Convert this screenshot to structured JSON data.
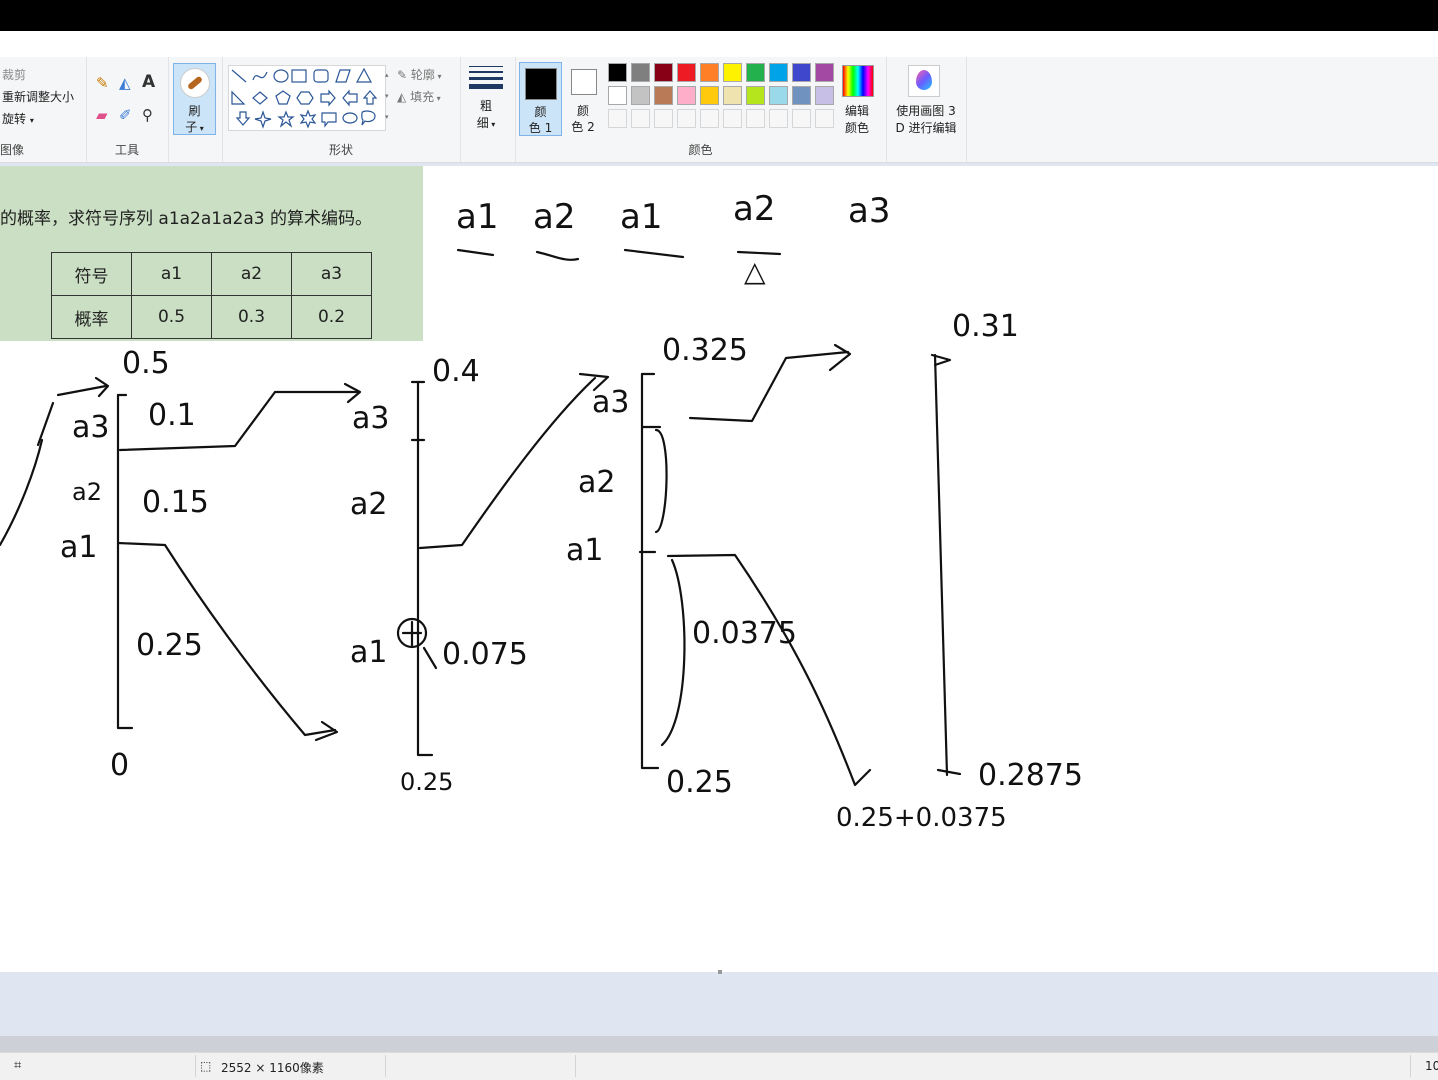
{
  "ribbon": {
    "image_group": {
      "crop": "裁剪",
      "resize": "重新调整大小",
      "rotate": "旋转",
      "label": "图像"
    },
    "tools_group": {
      "label": "工具"
    },
    "brush": {
      "line1": "刷",
      "line2": "子"
    },
    "shapes_group": {
      "outline": "轮廓",
      "fill": "填充",
      "label": "形状"
    },
    "size": {
      "line1": "粗",
      "line2": "细"
    },
    "color1": {
      "line1": "颜",
      "line2": "色 1"
    },
    "color2": {
      "line1": "颜",
      "line2": "色 2"
    },
    "edit_colors": {
      "line1": "编辑",
      "line2": "颜色"
    },
    "paint3d": {
      "line1": "使用画图 3",
      "line2": "D 进行编辑"
    },
    "colors_label": "颜色",
    "palette_row1": [
      "#000000",
      "#7f7f7f",
      "#880015",
      "#ed1c24",
      "#ff7f27",
      "#fff200",
      "#22b14c",
      "#00a2e8",
      "#3f48cc",
      "#a349a4"
    ],
    "palette_row2": [
      "#ffffff",
      "#c3c3c3",
      "#b97a57",
      "#ffaec9",
      "#ffc90e",
      "#efe4b0",
      "#b5e61d",
      "#99d9ea",
      "#7092be",
      "#c8bfe7"
    ],
    "color1_value": "#000000",
    "color2_value": "#ffffff"
  },
  "pasted_image": {
    "question": "的概率，求符号序列 a1a2a1a2a3 的算术编码。",
    "table": [
      [
        "符号",
        "a1",
        "a2",
        "a3"
      ],
      [
        "概率",
        "0.5",
        "0.3",
        "0.2"
      ]
    ]
  },
  "handwriting": {
    "sequence": [
      "a1",
      "a2",
      "a1",
      "a2",
      "a3"
    ],
    "col1": {
      "top": "0.5",
      "bottom": "0",
      "a3": "a3",
      "a2": "a2",
      "a1": "a1",
      "w3": "0.1",
      "w2": "0.15",
      "w1": "0.25"
    },
    "col2": {
      "top": "0.4",
      "bottom": "0.25",
      "a3": "a3",
      "a2": "a2",
      "a1": "a1",
      "w1": "0.075"
    },
    "col3": {
      "top": "0.325",
      "bottom": "0.25",
      "a3": "a3",
      "a2": "a2",
      "a1": "a1",
      "w1": "0.0375",
      "sum": "0.25+0.0375"
    },
    "col4": {
      "top": "0.31",
      "bottom": "0.2875"
    }
  },
  "status": {
    "dimensions": "2552 × 1160像素",
    "zoom": "10"
  }
}
